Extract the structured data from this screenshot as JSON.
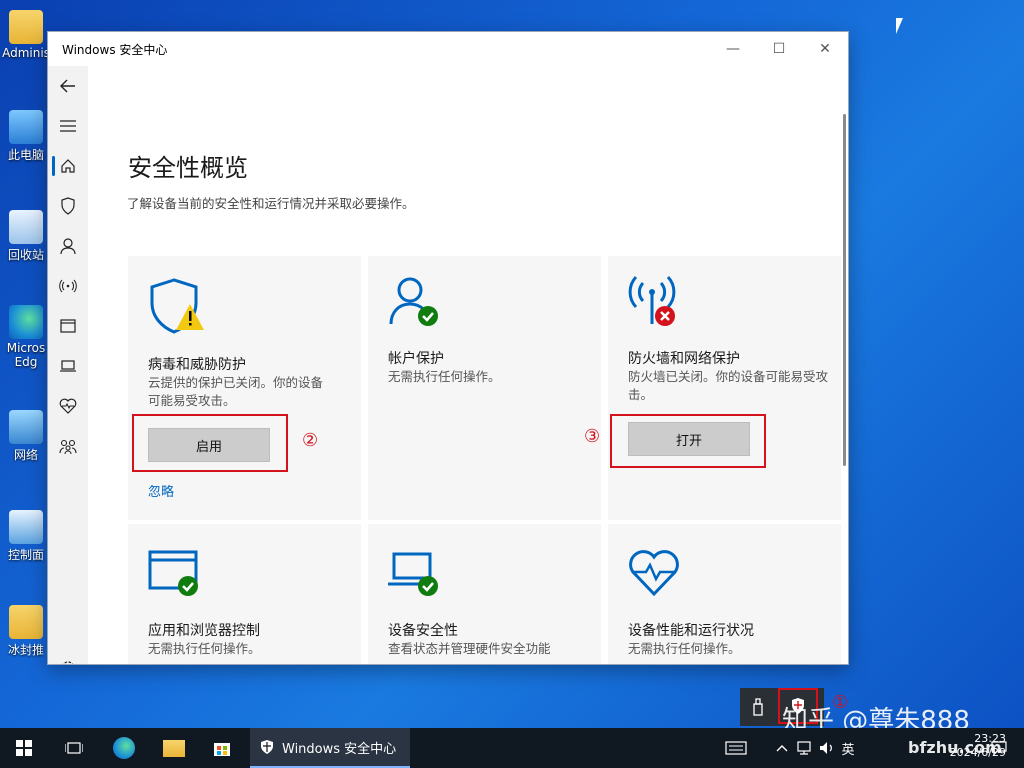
{
  "desktop": {
    "icons": [
      {
        "label": "Adminis"
      },
      {
        "label": "此电脑"
      },
      {
        "label": "回收站"
      },
      {
        "label": "Micros Edg"
      },
      {
        "label": "网络"
      },
      {
        "label": "控制面"
      },
      {
        "label": "冰封推"
      }
    ]
  },
  "window": {
    "title": "Windows 安全中心",
    "controls": {
      "minimize": "—",
      "maximize": "☐",
      "close": "✕"
    }
  },
  "page": {
    "title": "安全性概览",
    "subtitle": "了解设备当前的安全性和运行情况并采取必要操作。"
  },
  "cards": [
    {
      "title": "病毒和威胁防护",
      "desc": "云提供的保护已关闭。你的设备可能易受攻击。",
      "button": "启用",
      "link": "忽略",
      "status": "warning"
    },
    {
      "title": "帐户保护",
      "desc": "无需执行任何操作。",
      "status": "ok"
    },
    {
      "title": "防火墙和网络保护",
      "desc": "防火墙已关闭。你的设备可能易受攻击。",
      "button": "打开",
      "status": "error"
    },
    {
      "title": "应用和浏览器控制",
      "desc": "无需执行任何操作。",
      "status": "ok"
    },
    {
      "title": "设备安全性",
      "desc": "查看状态并管理硬件安全功能",
      "status": "ok"
    },
    {
      "title": "设备性能和运行状况",
      "desc": "无需执行任何操作。",
      "status": "ok"
    }
  ],
  "annotations": {
    "one": "①",
    "two": "②",
    "three": "③"
  },
  "taskbar": {
    "active_app": "Windows 安全中心",
    "ime": "英",
    "clock_time": "23:23",
    "clock_date": "2024/6/29"
  },
  "watermark": {
    "text1": "知乎 @尊朱888",
    "text2": "bfzhu.com"
  },
  "colors": {
    "accent": "#0067c0",
    "warning": "#f2c811",
    "ok": "#107c10",
    "error": "#d3121b"
  }
}
